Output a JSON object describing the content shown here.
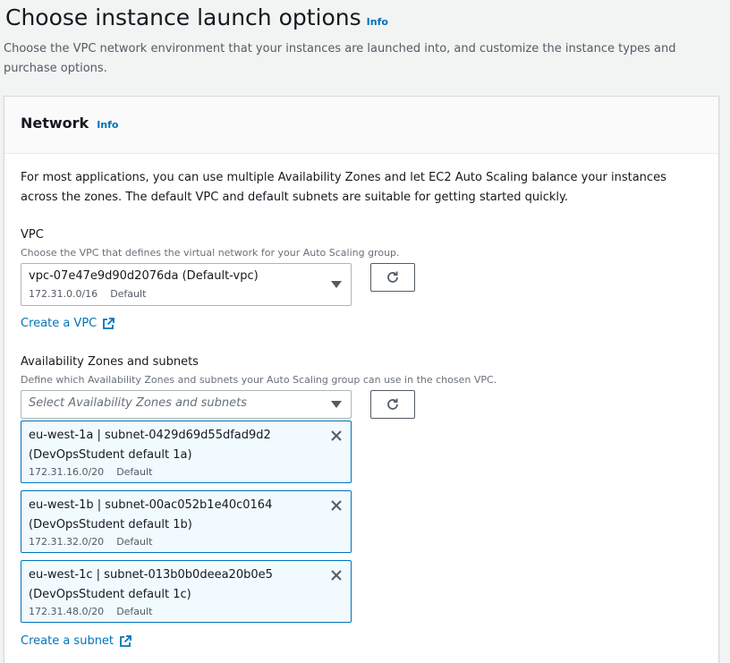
{
  "header": {
    "title": "Choose instance launch options",
    "info": "Info",
    "description": "Choose the VPC network environment that your instances are launched into, and customize the instance types and purchase options."
  },
  "network": {
    "title": "Network",
    "info": "Info",
    "intro": "For most applications, you can use multiple Availability Zones and let EC2 Auto Scaling balance your instances across the zones. The default VPC and default subnets are suitable for getting started quickly.",
    "vpc": {
      "label": "VPC",
      "description": "Choose the VPC that defines the virtual network for your Auto Scaling group.",
      "selected": "vpc-07e47e9d90d2076da (Default-vpc)",
      "cidr": "172.31.0.0/16",
      "tag": "Default",
      "create_link": "Create a VPC"
    },
    "subnets": {
      "label": "Availability Zones and subnets",
      "description": "Define which Availability Zones and subnets your Auto Scaling group can use in the chosen VPC.",
      "placeholder": "Select Availability Zones and subnets",
      "selected": [
        {
          "line1": "eu-west-1a | subnet-0429d69d55dfad9d2",
          "line2": "(DevOpsStudent default 1a)",
          "cidr": "172.31.16.0/20",
          "tag": "Default"
        },
        {
          "line1": "eu-west-1b | subnet-00ac052b1e40c0164",
          "line2": "(DevOpsStudent default 1b)",
          "cidr": "172.31.32.0/20",
          "tag": "Default"
        },
        {
          "line1": "eu-west-1c | subnet-013b0b0deea20b0e5",
          "line2": "(DevOpsStudent default 1c)",
          "cidr": "172.31.48.0/20",
          "tag": "Default"
        }
      ],
      "create_link": "Create a subnet"
    }
  }
}
